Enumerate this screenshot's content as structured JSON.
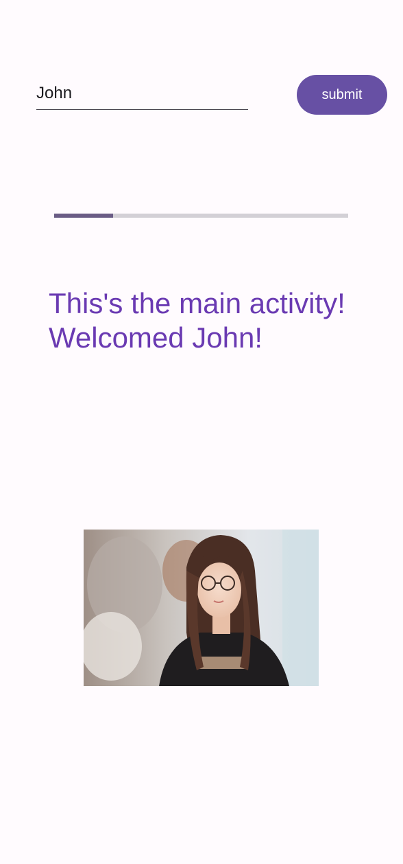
{
  "form": {
    "name_value": "John",
    "submit_label": "submit"
  },
  "progress": {
    "fraction": 0.2,
    "fill_color": "#6a5c85",
    "track_color": "#d3d0d6"
  },
  "message": {
    "line1": "This's the main activity!",
    "line2": "Welcomed John!",
    "color": "#6a3ab2"
  },
  "theme": {
    "accent": "#6750a4",
    "background": "#fffbfe"
  },
  "photo": {
    "subject": "woman-with-glasses-photo"
  }
}
